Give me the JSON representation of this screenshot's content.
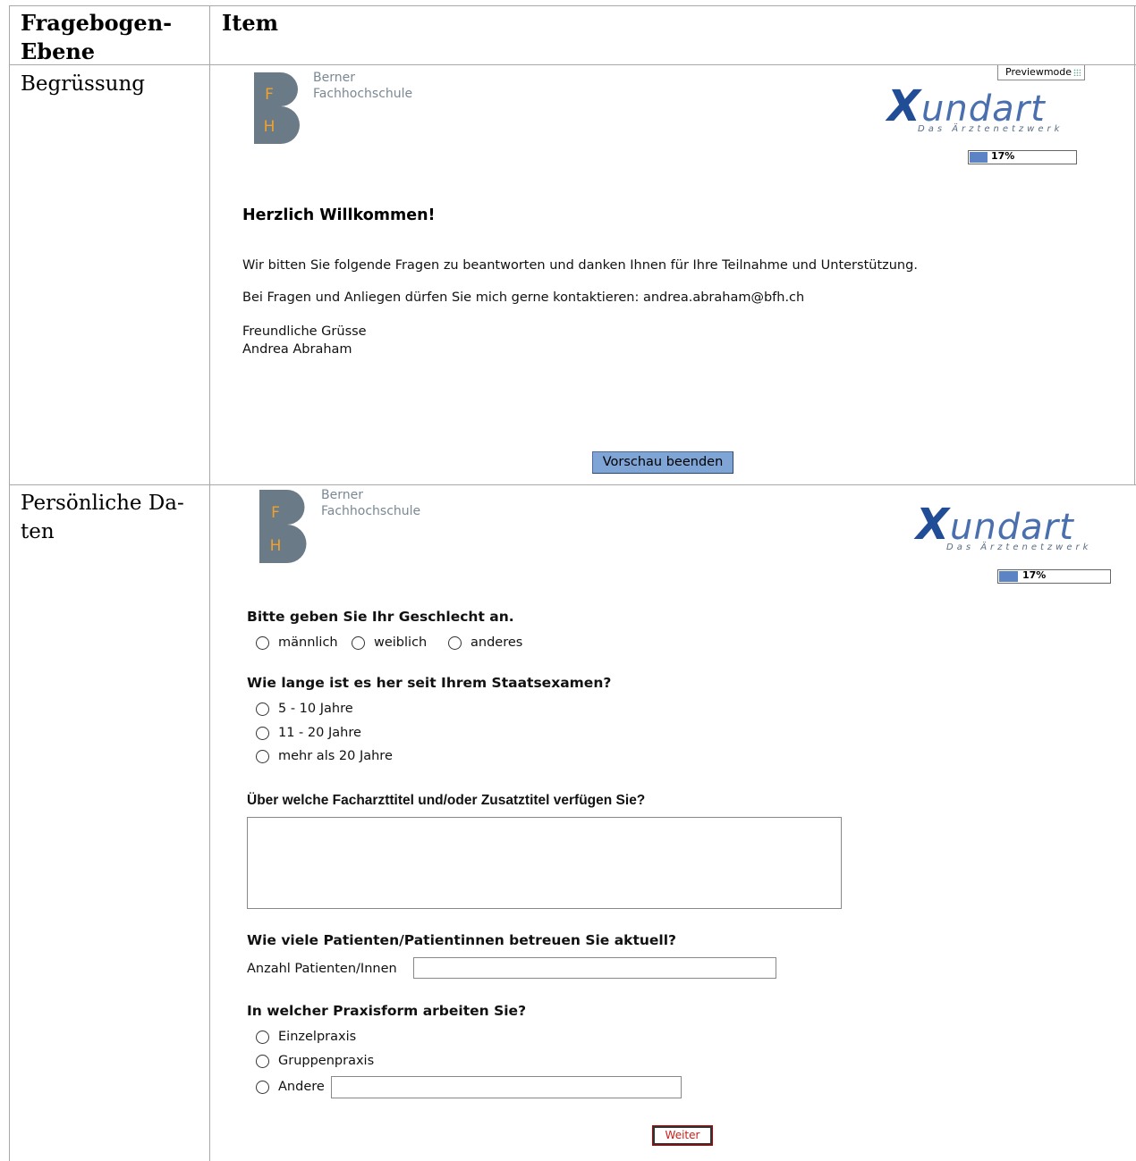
{
  "table": {
    "header_col1": "Fragebogen-\nEbene",
    "header_col2": "Item",
    "row1_label": "Begrüssung",
    "row2_label": "Persönliche Da-\nten"
  },
  "logos": {
    "bfh_line1": "Berner",
    "bfh_line2": "Fachhochschule",
    "bfh_letter_f": "F",
    "bfh_letter_h": "H",
    "xundart_x": "X",
    "xundart_rest": "undart",
    "xundart_sub": "Das Ärztenetzwerk",
    "brand_color": "#214c96"
  },
  "welcome": {
    "preview_label": "Previewmode",
    "progress_text": "17%",
    "progress_fraction": 0.17,
    "title": "Herzlich Willkommen!",
    "para1": "Wir bitten Sie folgende Fragen zu beantworten und danken Ihnen für Ihre Teilnahme und Unterstützung.",
    "para2": "Bei Fragen und Anliegen dürfen Sie mich gerne kontaktieren: andrea.abraham@bfh.ch",
    "greeting1": "Freundliche Grüsse",
    "greeting2": "Andrea Abraham",
    "end_button": "Vorschau beenden"
  },
  "personal": {
    "progress_text": "17%",
    "q_gender": "Bitte geben Sie Ihr Geschlecht an.",
    "gender_options": [
      "männlich",
      "weiblich",
      "anderes"
    ],
    "q_exam": "Wie lange ist es her seit Ihrem Staatsexamen?",
    "exam_options": [
      "5 - 10 Jahre",
      "11 - 20 Jahre",
      "mehr als 20 Jahre"
    ],
    "q_titles": "Über welche Facharzttitel und/oder Zusatztitel verfügen Sie?",
    "titles_value": "",
    "q_patients": "Wie viele Patienten/Patientinnen betreuen Sie aktuell?",
    "patients_label": "Anzahl Patienten/Innen",
    "patients_value": "",
    "q_practice": "In welcher Praxisform arbeiten Sie?",
    "practice_options": [
      "Einzelpraxis",
      "Gruppenpraxis",
      "Andere"
    ],
    "practice_other_value": "",
    "next_button": "Weiter"
  }
}
